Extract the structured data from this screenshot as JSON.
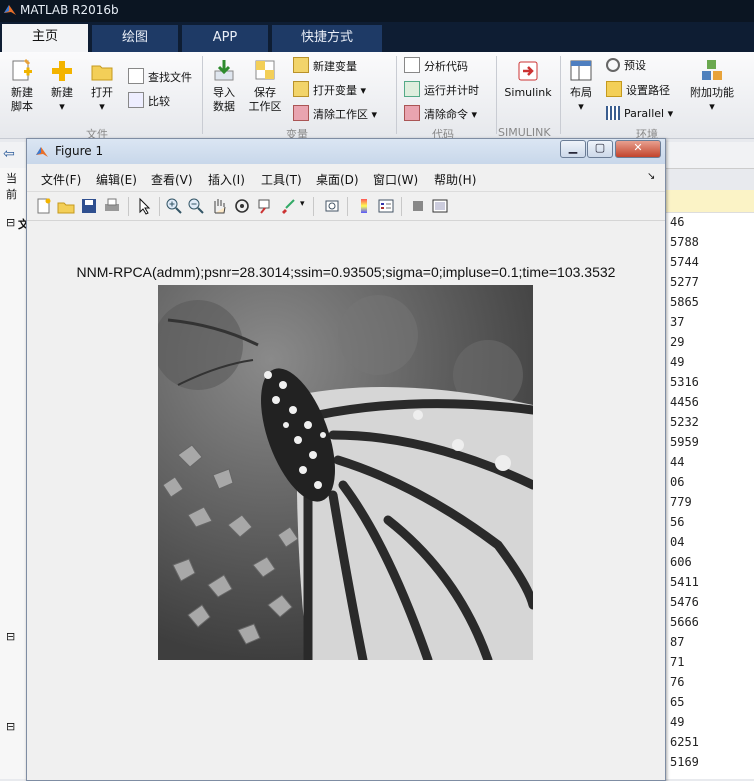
{
  "app": {
    "title": "MATLAB R2016b"
  },
  "tabs": [
    {
      "label": "主页"
    },
    {
      "label": "绘图"
    },
    {
      "label": "APP"
    },
    {
      "label": "快捷方式"
    }
  ],
  "ribbon": {
    "new_script": "新建\n脚本",
    "new": "新建",
    "open": "打开",
    "find_files": "查找文件",
    "compare": "比较",
    "import_data": "导入\n数据",
    "save_workspace": "保存\n工作区",
    "new_variable": "新建变量",
    "open_variable": "打开变量",
    "clear_workspace": "清除工作区",
    "analyze_code": "分析代码",
    "run_and_time": "运行并计时",
    "clear_commands": "清除命令",
    "simulink": "Simulink",
    "layout": "布局",
    "preferences": "预设",
    "set_path": "设置路径",
    "parallel": "Parallel",
    "addons": "附加功能",
    "group_file": "文件",
    "group_variable": "变量",
    "group_code": "代码",
    "group_simulink": "SIMULINK",
    "group_environment": "环境"
  },
  "side": {
    "current_label": "当前",
    "section_letter": "文"
  },
  "values_column": [
    "46",
    "5788",
    "5744",
    "5277",
    "5865",
    "37",
    "29",
    "49",
    "5316",
    "4456",
    "5232",
    "5959",
    "44",
    "06",
    "779",
    "56",
    "04",
    "606",
    "5411",
    "5476",
    "5666",
    "87",
    "71",
    "76",
    "65",
    "49",
    "6251",
    "5169"
  ],
  "figure": {
    "title": "Figure 1",
    "menus": [
      "文件(F)",
      "编辑(E)",
      "查看(V)",
      "插入(I)",
      "工具(T)",
      "桌面(D)",
      "窗口(W)",
      "帮助(H)"
    ],
    "plot_title": "NNM-RPCA(admm);psnr=28.3014;ssim=0.93505;sigma=0;impluse=0.1;time=103.3532"
  },
  "colors": {
    "title_bar": "#0b1522",
    "tab_strip": "#0e1d33",
    "tab_inactive": "#1e3a66",
    "figure_bg": "#f0f0f0",
    "highlight_row": "#fbf3c6"
  }
}
